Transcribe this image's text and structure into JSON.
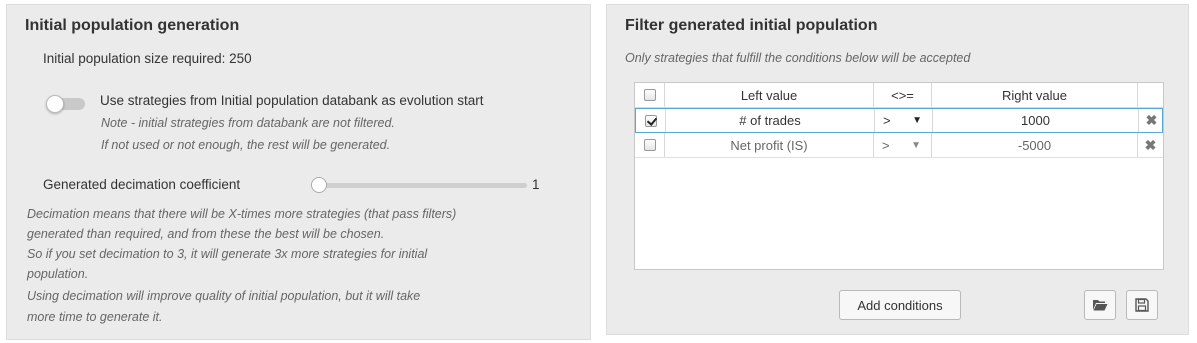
{
  "left": {
    "title": "Initial population generation",
    "size_label": "Initial population size required: 250",
    "toggle": {
      "label": "Use strategies from Initial population databank as evolution start",
      "checked": false,
      "note_1": "Note - initial strategies from databank are not filtered.",
      "note_2": "If not used or not enough, the rest will be generated."
    },
    "decimation": {
      "label": "Generated decimation coefficient",
      "value": "1",
      "slider_fraction": 0
    },
    "description": [
      "Decimation means that there will be X-times more strategies (that pass filters)",
      "generated than required, and from these the best will be chosen.",
      "So if you set decimation to 3, it will generate 3x more strategies for initial",
      "population.",
      "Using decimation will improve quality of initial population, but it will take",
      "more time to generate it."
    ]
  },
  "right": {
    "title": "Filter generated initial population",
    "subtitle": "Only strategies that fulfill the conditions below will be accepted",
    "table": {
      "headers": {
        "left": "Left value",
        "op": "<>=",
        "right": "Right value"
      },
      "rows": [
        {
          "checked": true,
          "left": "# of trades",
          "op": ">",
          "right": "1000"
        },
        {
          "checked": false,
          "left": "Net profit (IS)",
          "op": ">",
          "right": "-5000"
        }
      ]
    },
    "buttons": {
      "add": "Add conditions"
    }
  },
  "icons": {
    "dropdown": "caret-down-icon",
    "delete": "delete-icon",
    "open": "folder-open-icon",
    "save": "save-icon"
  },
  "colors": {
    "selected_row_border": "#5aa9d6",
    "panel_bg": "#ebebeb"
  }
}
